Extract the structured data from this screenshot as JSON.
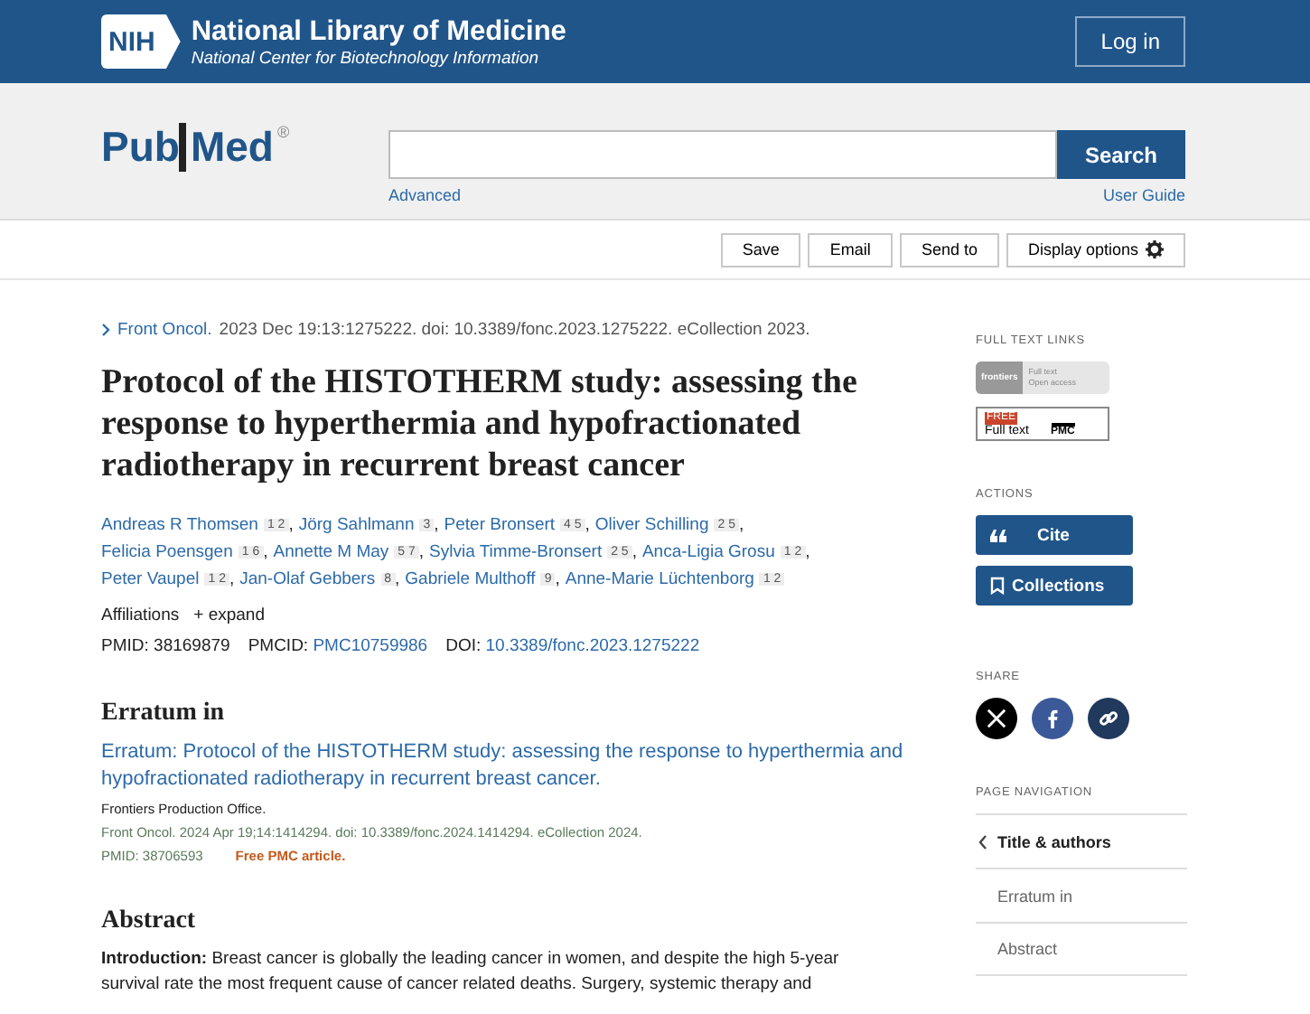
{
  "header": {
    "logo": "NIH",
    "title": "National Library of Medicine",
    "subtitle": "National Center for Biotechnology Information",
    "login": "Log in"
  },
  "search": {
    "logo_left": "Pub",
    "logo_right": "Med",
    "registered": "®",
    "button": "Search",
    "advanced": "Advanced",
    "guide": "User Guide"
  },
  "toolbar": [
    "Save",
    "Email",
    "Send to",
    "Display options"
  ],
  "citation": {
    "journal": "Front Oncol.",
    "details": "2023 Dec 19:13:1275222. doi: 10.3389/fonc.2023.1275222. eCollection 2023."
  },
  "title": "Protocol of the HISTOTHERM study: assessing the response to hyperthermia and hypofractionated radiotherapy in recurrent breast cancer",
  "author_lines": [
    [
      {
        "name": "Andreas R Thomsen",
        "affiliations": "1 2",
        "separator": ","
      },
      {
        "name": "Jörg Sahlmann",
        "affiliations": "3",
        "separator": ","
      },
      {
        "name": "Peter Bronsert",
        "affiliations": "4 5",
        "separator": ","
      },
      {
        "name": "Oliver Schilling",
        "affiliations": "2 5",
        "separator": ","
      }
    ],
    [
      {
        "name": "Felicia Poensgen",
        "affiliations": "1 6",
        "separator": ","
      },
      {
        "name": "Annette M May",
        "affiliations": "5 7",
        "separator": ","
      },
      {
        "name": "Sylvia Timme-Bronsert",
        "affiliations": "2 5",
        "separator": ","
      },
      {
        "name": "Anca-Ligia Grosu",
        "affiliations": "1 2",
        "separator": ","
      }
    ],
    [
      {
        "name": "Peter Vaupel",
        "affiliations": "1 2",
        "separator": ","
      },
      {
        "name": "Jan-Olaf Gebbers",
        "affiliations": "8",
        "separator": ","
      },
      {
        "name": "Gabriele Multhoff",
        "affiliations": "9",
        "separator": ","
      },
      {
        "name": "Anne-Marie Lüchtenborg",
        "affiliations": "1 2"
      }
    ]
  ],
  "affiliations": {
    "label": "Affiliations",
    "expand": "+ expand"
  },
  "ids": [
    {
      "label": "PMID:",
      "value": "38169879",
      "link": false
    },
    {
      "label": "PMCID:",
      "value": "PMC10759986",
      "link": true
    },
    {
      "label": "DOI:",
      "value": "10.3389/fonc.2023.1275222",
      "link": true
    }
  ],
  "erratum": {
    "heading": "Erratum in",
    "title": "Erratum: Protocol of the HISTOTHERM study: assessing the response to hyperthermia and hypofractionated radiotherapy in recurrent breast cancer.",
    "authors": "Frontiers Production Office.",
    "source": "Front Oncol. 2024 Apr 19;14:1414294. doi: 10.3389/fonc.2024.1414294. eCollection 2024.",
    "pmid": "PMID: 38706593",
    "free": "Free PMC article."
  },
  "abstract": {
    "heading": "Abstract",
    "text": "**Introduction:** Breast cancer is globally the leading cancer in women, and despite the high 5-year survival rate the most frequent cause of cancer related deaths. Surgery, systemic therapy and"
  },
  "sidebar": {
    "full_text_heading": "FULL TEXT LINKS",
    "frontiers": {
      "name": "frontiers",
      "line1": "Full text",
      "line2": "Open access"
    },
    "pmc": {
      "free": "FREE",
      "label": "Full text",
      "name": "PMC"
    },
    "actions_heading": "ACTIONS",
    "actions": [
      {
        "kind": "cite",
        "label": "Cite"
      },
      {
        "kind": "collections",
        "label": "Collections"
      }
    ],
    "share_heading": "SHARE",
    "share": [
      {
        "kind": "x",
        "color": "#000000"
      },
      {
        "kind": "facebook",
        "color": "#3b5998"
      },
      {
        "kind": "link",
        "color": "#20395c"
      }
    ],
    "nav_heading": "PAGE NAVIGATION",
    "nav": [
      {
        "label": "Title & authors",
        "selected": true
      },
      {
        "label": "Erratum in",
        "selected": false
      },
      {
        "label": "Abstract",
        "selected": false
      }
    ]
  }
}
